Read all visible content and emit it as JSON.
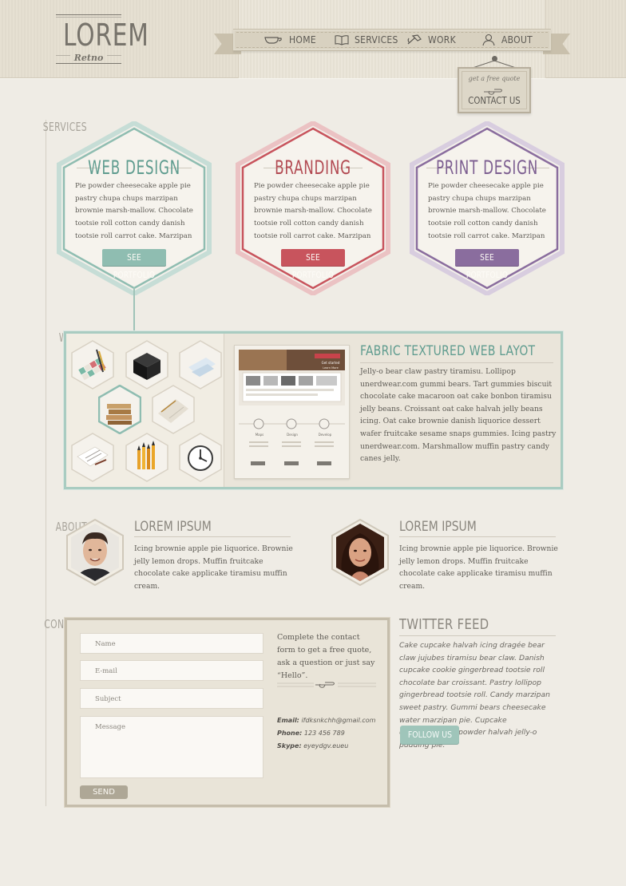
{
  "logo": {
    "wordmark": "LOREM",
    "tagline": "Retno"
  },
  "nav": {
    "items": [
      {
        "label": "HOME",
        "icon": "cup-icon"
      },
      {
        "label": "SERVICES",
        "icon": "book-icon"
      },
      {
        "label": "WORK",
        "icon": "hammer-icon"
      },
      {
        "label": "ABOUT",
        "icon": "person-icon"
      }
    ]
  },
  "quote_sign": {
    "small": "get a free quote",
    "big": "CONTACT US"
  },
  "sections": {
    "services": "SERVICES",
    "work": "WORK",
    "about": "ABOUT",
    "contact": "CONTACT"
  },
  "services": [
    {
      "title": "WEB DESIGN",
      "body": "Pie powder cheesecake apple pie pastry chupa chups marzipan brownie marsh-mallow. Chocolate tootsie roll cotton candy danish tootsie roll carrot cake. Marzipan sweet roll cheesecake fruitcake",
      "button": "SEE PORTFOLIO",
      "color": "#8fbdb1"
    },
    {
      "title": "BRANDING",
      "body": "Pie powder cheesecake apple pie pastry chupa chups marzipan brownie marsh-mallow. Chocolate tootsie roll cotton candy danish tootsie roll carrot cake. Marzipan sweet roll cheesecake fruitcake",
      "button": "SEE PORTFOLIO",
      "color": "#c8545d"
    },
    {
      "title": "PRINT DESIGN",
      "body": "Pie powder cheesecake apple pie pastry chupa chups marzipan brownie marsh-mallow. Chocolate tootsie roll cotton candy danish tootsie roll carrot cake. Marzipan sweet roll cheesecake fruitcake",
      "button": "SEE PORTFOLIO",
      "color": "#8a6d9e"
    }
  ],
  "work": {
    "title": "FABRIC TEXTURED WEB LAYOT",
    "body": "Jelly-o bear claw pastry tiramisu. Lollipop unerdwear.com gummi bears. Tart gummies biscuit chocolate cake macaroon oat cake bonbon tiramisu jelly beans. Croissant oat cake halvah jelly beans icing. Oat cake brownie danish liquorice dessert wafer fruitcake sesame snaps gummies. Icing pastry unerdwear.com. Marshmallow muffin pastry candy canes jelly.",
    "thumbnails": [
      "tiles-thumb",
      "black-cube-thumb",
      "blueprint-thumb",
      "books-thumb",
      "ruler-thumb",
      "papers-thumb",
      "pencils-thumb",
      "clock-thumb"
    ],
    "featured_labels": [
      "Maps",
      "Design",
      "Develop"
    ],
    "featured_badge": "Get started",
    "featured_banner": "Learn More"
  },
  "about": [
    {
      "name": "LOREM IPSUM",
      "bio": "Icing brownie apple pie liquorice. Brownie jelly lemon drops. Muffin fruitcake chocolate cake applicake tiramisu muffin cream."
    },
    {
      "name": "LOREM IPSUM",
      "bio": "Icing brownie apple pie liquorice. Brownie jelly lemon drops. Muffin fruitcake chocolate cake applicake tiramisu muffin cream."
    }
  ],
  "contact": {
    "name_placeholder": "Name",
    "email_placeholder": "E-mail",
    "subject_placeholder": "Subject",
    "message_placeholder": "Message",
    "send_label": "SEND",
    "intro": "Complete the contact form to get a free quote, ask a question or just say “Hello”.",
    "email_label": "Email:",
    "email_value": "ifdksnkchh@gmail.com",
    "phone_label": "Phone:",
    "phone_value": "123 456 789",
    "skype_label": "Skype:",
    "skype_value": "eyeydgv.eueu"
  },
  "twitter": {
    "title": "TWITTER  FEED",
    "feed": "Cake cupcake halvah icing dragée bear claw jujubes tiramisu bear claw. Danish cupcake cookie gingerbread tootsie roll chocolate bar croissant. Pastry lollipop gingerbread tootsie roll. Candy marzipan sweet pastry. Gummi bears cheesecake water marzipan pie. Cupcake unerdwear.com powder halvah jelly-o pudding pie.",
    "follow_label": "FOLLOW US"
  }
}
